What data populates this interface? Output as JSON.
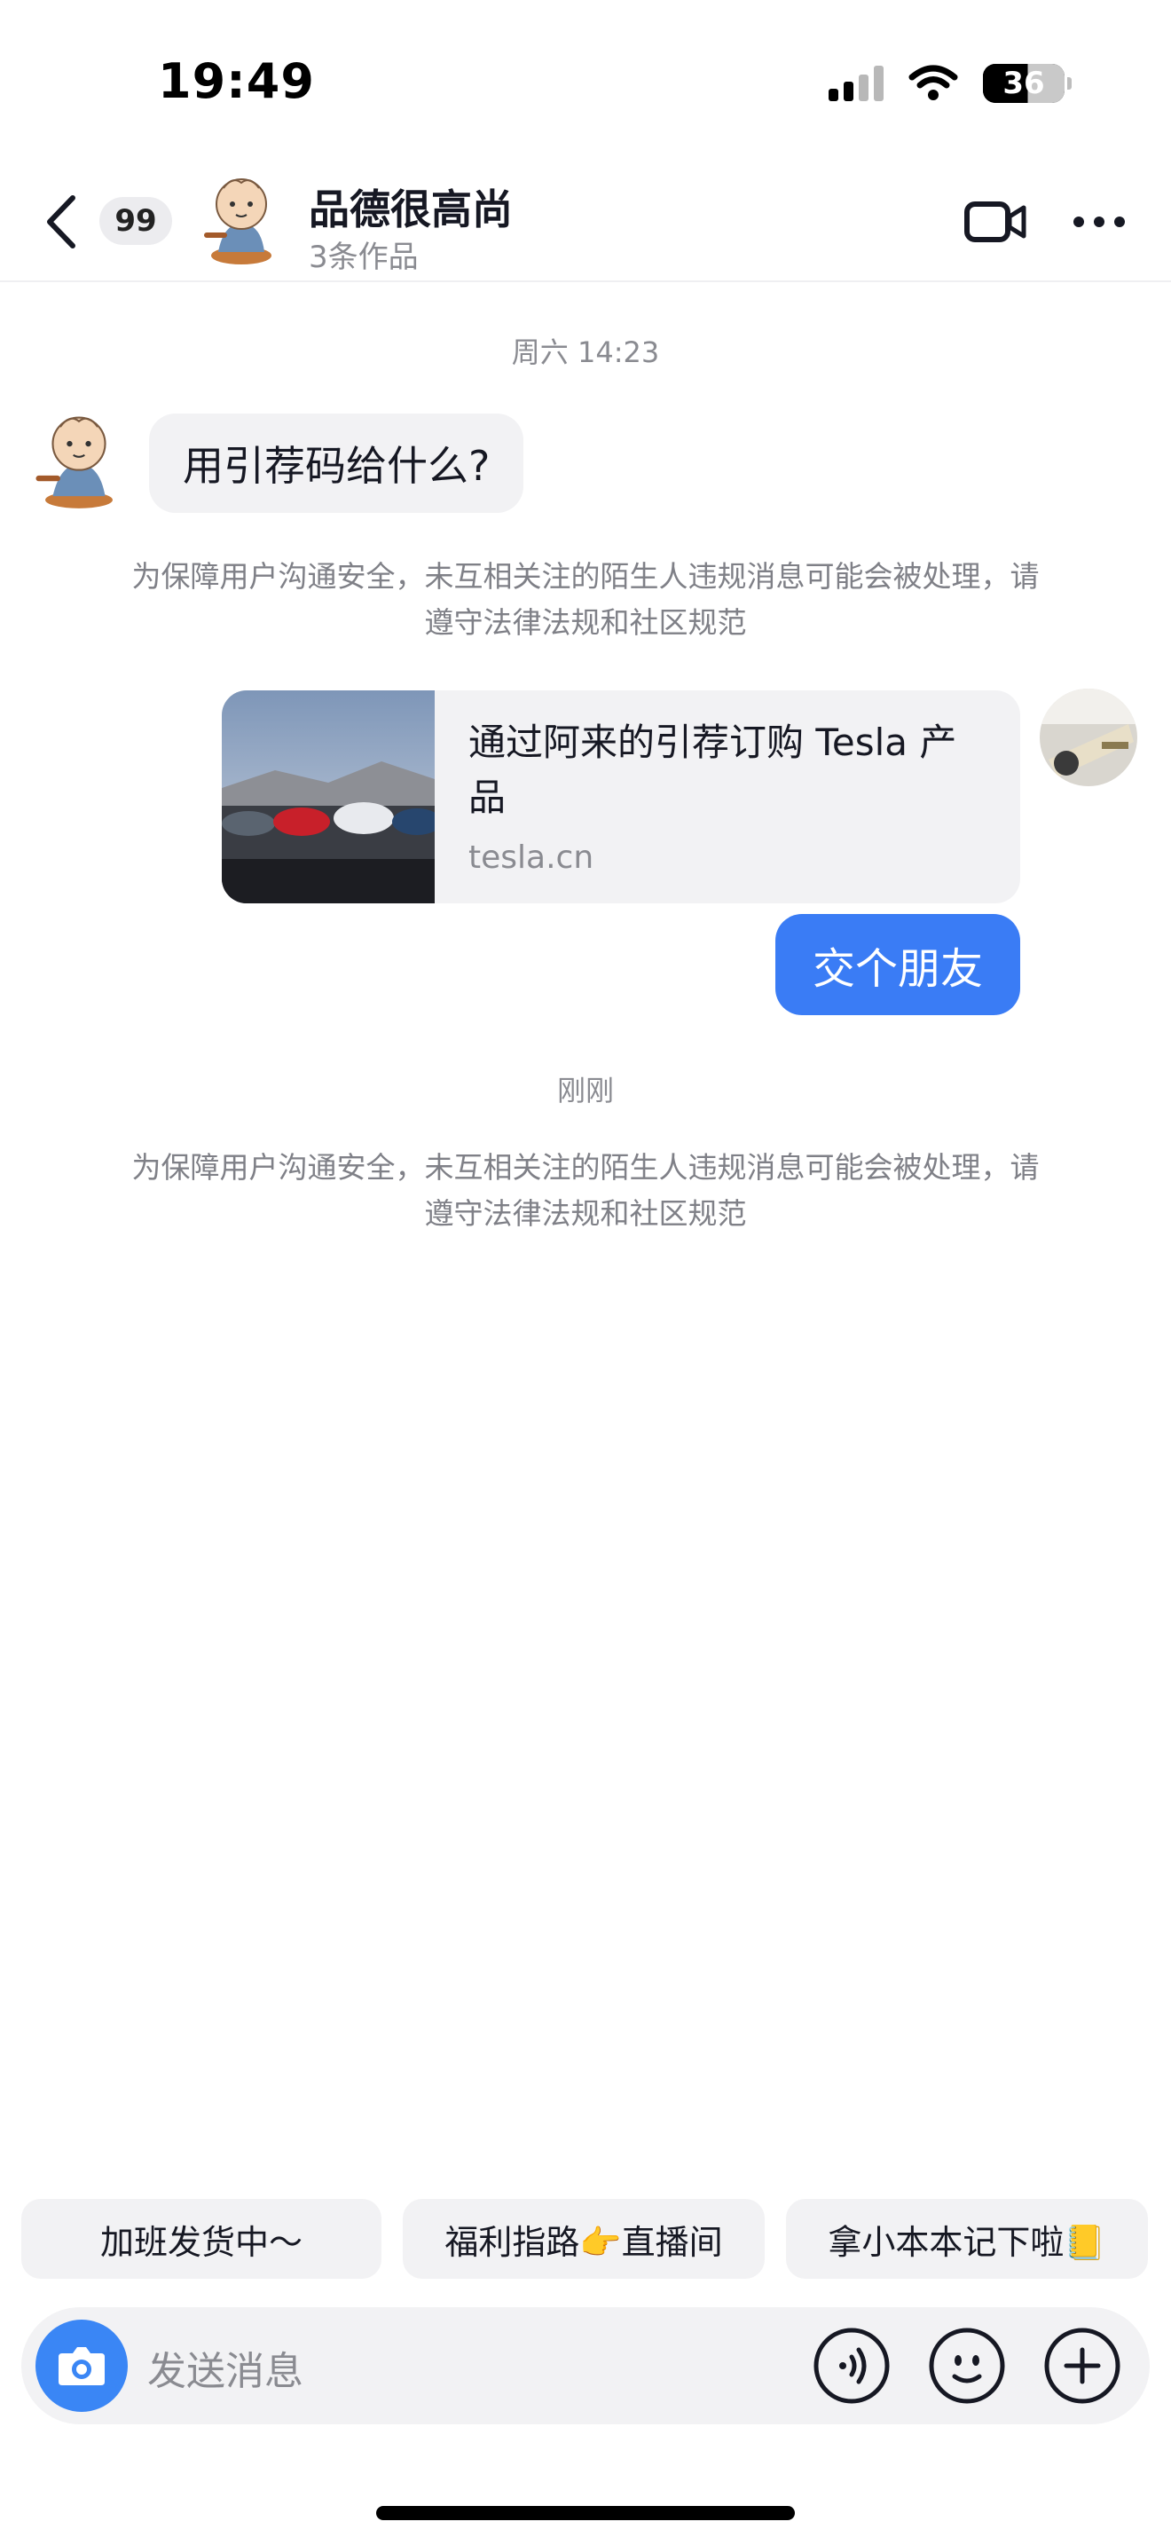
{
  "status_bar": {
    "time": "19:49",
    "battery": "36"
  },
  "header": {
    "back_icon": "chevron-left-icon",
    "unread_badge": "99",
    "name": "品德很高尚",
    "subtitle": "3条作品",
    "video_icon": "video-call-icon",
    "more_icon": "more-dots-icon"
  },
  "chat": {
    "timestamp_1": "周六 14:23",
    "message_other": "用引荐码给什么?",
    "notice_1": "为保障用户沟通安全，未互相关注的陌生人违规消息可能会被处理，请遵守法律法规和社区规范",
    "link_card": {
      "title": "通过阿来的引荐订购 Tesla 产品",
      "domain": "tesla.cn"
    },
    "message_me": "交个朋友",
    "timestamp_2": "刚刚",
    "notice_2": "为保障用户沟通安全，未互相关注的陌生人违规消息可能会被处理，请遵守法律法规和社区规范"
  },
  "quick_replies": [
    "加班发货中～",
    "福利指路👉直播间",
    "拿小本本记下啦📒"
  ],
  "input": {
    "placeholder": "发送消息",
    "icons": [
      "camera-icon",
      "voice-icon",
      "emoji-icon",
      "plus-icon"
    ]
  },
  "colors": {
    "accent_blue": "#3a7cf5",
    "bubble_gray": "#f2f2f4",
    "muted_text": "#8a8b91"
  }
}
